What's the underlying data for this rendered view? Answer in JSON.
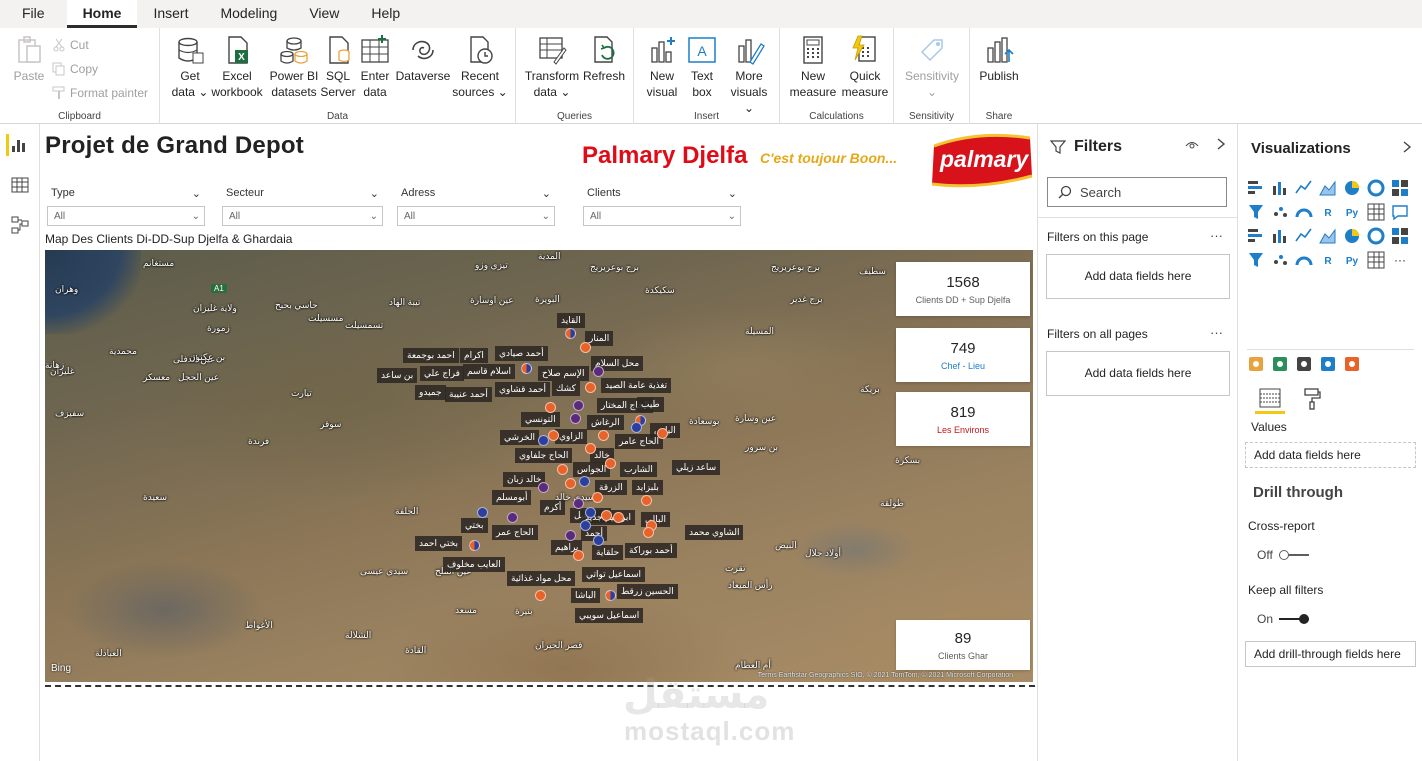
{
  "menu": {
    "items": [
      "File",
      "Home",
      "Insert",
      "Modeling",
      "View",
      "Help"
    ],
    "active": "Home"
  },
  "ribbon": {
    "clipboard": {
      "paste": "Paste",
      "cut": "Cut",
      "copy": "Copy",
      "format_painter": "Format painter",
      "label": "Clipboard"
    },
    "data": {
      "label": "Data",
      "get_data": [
        "Get",
        "data ⌄"
      ],
      "excel": [
        "Excel",
        "workbook"
      ],
      "pbi": [
        "Power BI",
        "datasets"
      ],
      "sql": [
        "SQL",
        "Server"
      ],
      "enter": [
        "Enter",
        "data"
      ],
      "dataverse": [
        "Dataverse",
        ""
      ],
      "recent": [
        "Recent",
        "sources ⌄"
      ]
    },
    "queries": {
      "label": "Queries",
      "transform": [
        "Transform",
        "data ⌄"
      ],
      "refresh": [
        "Refresh",
        ""
      ]
    },
    "insert": {
      "label": "Insert",
      "new_visual": [
        "New",
        "visual"
      ],
      "text_box": [
        "Text",
        "box"
      ],
      "more_visuals": [
        "More",
        "visuals ⌄"
      ]
    },
    "calculations": {
      "label": "Calculations",
      "new_measure": [
        "New",
        "measure"
      ],
      "quick_measure": [
        "Quick",
        "measure"
      ]
    },
    "sensitivity": {
      "label": "Sensitivity",
      "btn": [
        "Sensitivity",
        "⌄"
      ]
    },
    "share": {
      "label": "Share",
      "publish": [
        "Publish",
        ""
      ]
    }
  },
  "report": {
    "title": "Projet de Grand Depot",
    "brand": "Palmary Djelfa",
    "slogan": "C'est toujour Boon...",
    "logo_text": "palmary",
    "slicers": [
      {
        "label": "Type",
        "value": "All"
      },
      {
        "label": "Secteur",
        "value": "All"
      },
      {
        "label": "Adress",
        "value": "All"
      },
      {
        "label": "Clients",
        "value": "All"
      }
    ],
    "map_title": "Map Des Clients Di-DD-Sup Djelfa & Ghardaia",
    "kpis": [
      {
        "value": "1568",
        "label": "Clients DD + Sup Djelfa",
        "color": "#605e5c"
      },
      {
        "value": "749",
        "label": "Chef - Lieu",
        "color": "#1e7ec8"
      },
      {
        "value": "819",
        "label": "Les Environs",
        "color": "#c4161c"
      },
      {
        "value": "89",
        "label": "Clients Ghar",
        "color": "#605e5c"
      }
    ],
    "map": {
      "bing": "Bing",
      "attribution": "Terms  Earthstar Geographics SIO, © 2021 TomTom, © 2021 Microsoft Corporation",
      "road": "A1",
      "places": [
        "مستغانم",
        "المدية",
        "البويرة",
        "تيزي وزو",
        "سطيف",
        "وهران",
        "ولاية غليزان",
        "زمورة",
        "مسسيلت",
        "تيبة الهاد",
        "عين الدفلى",
        "برج بوعريريج",
        "برج غدير",
        "عين اوسارة",
        "محمدية",
        "غليزان",
        "معسكر",
        "بن عكنون",
        "زهانة",
        "عين الحجل",
        "تيارت",
        "سوقر",
        "فرندة",
        "سعيدة",
        "بوسعادة",
        "بسكرة",
        "سيدي خالد",
        "طولقة",
        "أولاد جلال",
        "سيدي عيسى",
        "تقرت",
        "البيض",
        "الأغواط",
        "الشلالة",
        "قصر الحيران",
        "أم العظام",
        "المسيلة",
        "بنيرة",
        "مسعد",
        "رأس الميعاد",
        "العبادلة",
        "القادة",
        "عين الملح",
        "سكيكدة",
        "تسمسيلت",
        "سفيزف",
        "بريكة",
        "الجلفة",
        "حاسي بحبح",
        "بن سرور",
        "عين وسارة",
        "برج بوعريريج"
      ],
      "clients": [
        "القايد",
        "المنار",
        "أحمد صيادي",
        "محل السلام",
        "احمد بوجمعة",
        "اكرام",
        "اسلام قاسم",
        "الإسم صلاح",
        "تغذية عامة الصيد",
        "بن ساعد",
        "فراج علي",
        "كشك",
        "أحمد قشاوي",
        "جميدو",
        "أحمد عنيبة",
        "الحاج المختار",
        "طيب",
        "التونسي",
        "الرغاش",
        "الياس",
        "الخرشي",
        "الزاوي",
        "الحاج عامر",
        "الحاج جلفاوي",
        "خالد",
        "الجواس",
        "الشارب",
        "ساعد زيلي",
        "خالد زبان",
        "بلبزايد",
        "الزرقة",
        "أبومسلم",
        "أكرم",
        "اسماعيل",
        "ابراهيم جديد",
        "البالي",
        "بختي",
        "أحمد",
        "الحاج عمر",
        "الشاوي محمد",
        "بختي احمد",
        "براهيم",
        "حلقاية",
        "أحمد بوراكة",
        "العايب مخلوف",
        "محل مواد غذائية",
        "اسماعيل تواتي",
        "الباشا",
        "الحسين زرقط",
        "اسماعيل سويبي"
      ]
    },
    "watermark": [
      "مستقل",
      "mostaql.com"
    ]
  },
  "filters": {
    "title": "Filters",
    "search_placeholder": "Search",
    "on_page": "Filters on this page",
    "on_all": "Filters on all pages",
    "add_fields": "Add data fields here",
    "more": "···"
  },
  "visualizations": {
    "title": "Visualizations",
    "values_label": "Values",
    "values_drop": "Add data fields here",
    "drill_title": "Drill through",
    "cross_report": "Cross-report",
    "cross_state": "Off",
    "keep_filters": "Keep all filters",
    "keep_state": "On",
    "drill_drop": "Add drill-through fields here",
    "more": "···"
  }
}
